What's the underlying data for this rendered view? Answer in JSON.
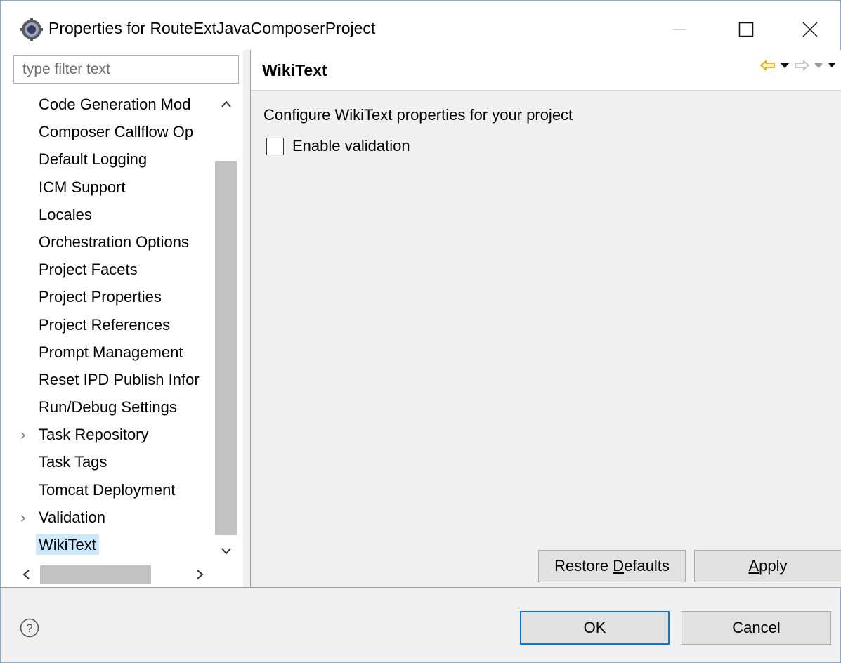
{
  "window": {
    "title": "Properties for RouteExtJavaComposerProject",
    "app_icon": "eclipse-gear-icon"
  },
  "filter": {
    "placeholder": "type filter text",
    "value": ""
  },
  "tree": {
    "items": [
      {
        "label": "Code Generation Mod",
        "expandable": false
      },
      {
        "label": "Composer Callflow Op",
        "expandable": false
      },
      {
        "label": "Default Logging",
        "expandable": false
      },
      {
        "label": "ICM Support",
        "expandable": false
      },
      {
        "label": "Locales",
        "expandable": false
      },
      {
        "label": "Orchestration Options",
        "expandable": false
      },
      {
        "label": "Project Facets",
        "expandable": false
      },
      {
        "label": "Project Properties",
        "expandable": false
      },
      {
        "label": "Project References",
        "expandable": false
      },
      {
        "label": "Prompt Management",
        "expandable": false
      },
      {
        "label": "Reset IPD Publish Infor",
        "expandable": false
      },
      {
        "label": "Run/Debug Settings",
        "expandable": false
      },
      {
        "label": "Task Repository",
        "expandable": true
      },
      {
        "label": "Task Tags",
        "expandable": false
      },
      {
        "label": "Tomcat Deployment",
        "expandable": false
      },
      {
        "label": "Validation",
        "expandable": true
      },
      {
        "label": "WikiText",
        "expandable": false,
        "selected": true
      }
    ]
  },
  "page": {
    "title": "WikiText",
    "description": "Configure WikiText properties for your project",
    "enable_validation_label": "Enable validation",
    "enable_validation_checked": false
  },
  "buttons": {
    "restore_defaults_pre": "Restore ",
    "restore_defaults_mnemonic": "D",
    "restore_defaults_post": "efaults",
    "apply_mnemonic": "A",
    "apply_post": "pply",
    "ok": "OK",
    "cancel": "Cancel"
  },
  "colors": {
    "accent": "#0078d7",
    "selection": "#cce8ff",
    "nav_back_arrow": "#e8a000"
  }
}
